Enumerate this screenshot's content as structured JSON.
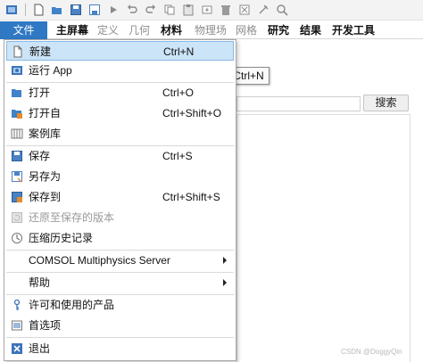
{
  "toolbar": {
    "icons": [
      "app-icon",
      "new-icon",
      "open-icon",
      "save-icon",
      "save-as-icon",
      "run-icon",
      "undo-icon",
      "redo-icon",
      "copy-icon",
      "paste-icon",
      "duplicate-icon",
      "delete-icon",
      "clear-icon",
      "pin-icon",
      "zoom-icon"
    ]
  },
  "ribbon": {
    "tabs": [
      "文件",
      "主屏幕",
      "定义",
      "几何",
      "材料",
      "物理场",
      "网格",
      "研究",
      "结果",
      "开发工具"
    ]
  },
  "search": {
    "button_label": "搜索"
  },
  "tooltip": {
    "text": "Ctrl+N"
  },
  "menu": {
    "items": [
      {
        "label": "新建",
        "shortcut": "Ctrl+N",
        "icon": "new-file-icon",
        "selected": true
      },
      {
        "label": "运行 App",
        "shortcut": "",
        "icon": "run-app-icon"
      },
      {
        "label": "打开",
        "shortcut": "Ctrl+O",
        "icon": "open-folder-icon"
      },
      {
        "label": "打开自",
        "shortcut": "Ctrl+Shift+O",
        "icon": "open-from-icon"
      },
      {
        "label": "案例库",
        "shortcut": "",
        "icon": "library-icon"
      },
      {
        "label": "保存",
        "shortcut": "Ctrl+S",
        "icon": "save-icon"
      },
      {
        "label": "另存为",
        "shortcut": "",
        "icon": "save-as-icon"
      },
      {
        "label": "保存到",
        "shortcut": "Ctrl+Shift+S",
        "icon": "save-to-icon"
      },
      {
        "label": "还原至保存的版本",
        "shortcut": "",
        "icon": "revert-icon",
        "disabled": true
      },
      {
        "label": "压缩历史记录",
        "shortcut": "",
        "icon": "compact-history-icon"
      },
      {
        "label": "COMSOL Multiphysics Server",
        "shortcut": "",
        "icon": "",
        "submenu": true
      },
      {
        "label": "帮助",
        "shortcut": "",
        "icon": "",
        "submenu": true
      },
      {
        "label": "许可和使用的产品",
        "shortcut": "",
        "icon": "license-icon"
      },
      {
        "label": "首选项",
        "shortcut": "",
        "icon": "preferences-icon"
      },
      {
        "label": "退出",
        "shortcut": "",
        "icon": "exit-icon"
      }
    ]
  },
  "watermark": "CSDN @DoggyQin",
  "colors": {
    "accent": "#2f78c4",
    "selection": "#cce4f7"
  }
}
